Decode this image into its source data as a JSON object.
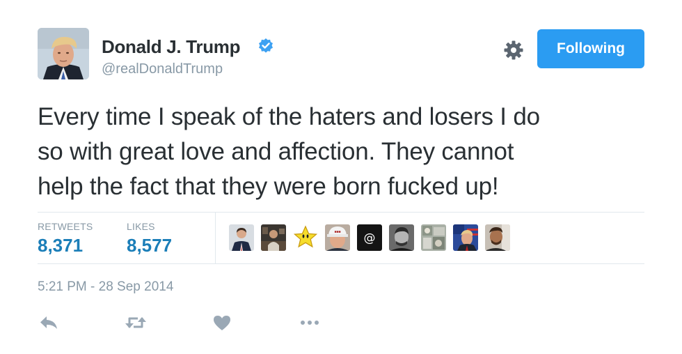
{
  "user": {
    "name": "Donald J. Trump",
    "handle": "@realDonaldTrump",
    "verified": true
  },
  "header": {
    "follow_label": "Following",
    "settings_icon": "gear-icon"
  },
  "tweet": {
    "lines": [
      "Every time I speak of the haters and losers I do",
      "so with great love and affection. They cannot",
      "help the fact that they were born fucked up!"
    ],
    "timestamp": "5:21 PM - 28 Sep 2014"
  },
  "stats": {
    "retweets_label": "RETWEETS",
    "retweets_value": "8,371",
    "likes_label": "LIKES",
    "likes_value": "8,577"
  },
  "likers": [
    {
      "icon": "suited-man-avatar"
    },
    {
      "icon": "dark-photo-avatar"
    },
    {
      "icon": "star-avatar"
    },
    {
      "icon": "cap-man-avatar"
    },
    {
      "icon": "at-sign-avatar"
    },
    {
      "icon": "bw-portrait-avatar"
    },
    {
      "icon": "collage-avatar"
    },
    {
      "icon": "flag-man-avatar"
    },
    {
      "icon": "portrait-avatar"
    }
  ],
  "actions": [
    {
      "icon": "reply-icon"
    },
    {
      "icon": "retweet-icon"
    },
    {
      "icon": "like-heart-icon"
    },
    {
      "icon": "more-dots-icon"
    }
  ],
  "colors": {
    "accent": "#2b9cf2",
    "stat_value": "#1b7eb8",
    "muted": "#8899a6",
    "text": "#292f33"
  }
}
